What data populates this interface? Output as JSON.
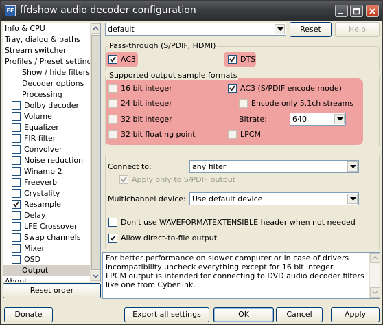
{
  "window": {
    "title": "ffdshow audio decoder configuration",
    "app_icon": "ffdshow-icon"
  },
  "tree": {
    "items": [
      {
        "label": "Info & CPU",
        "checkbox": null
      },
      {
        "label": "Tray, dialog & paths",
        "checkbox": null
      },
      {
        "label": "Stream switcher",
        "checkbox": null
      },
      {
        "label": "Profiles / Preset settings",
        "checkbox": null
      },
      {
        "label": "Show / hide filters",
        "checkbox": null
      },
      {
        "label": "Decoder options",
        "checkbox": null
      },
      {
        "label": "Processing",
        "checkbox": null
      },
      {
        "label": "Dolby decoder",
        "checkbox": false
      },
      {
        "label": "Volume",
        "checkbox": false
      },
      {
        "label": "Equalizer",
        "checkbox": false
      },
      {
        "label": "FIR filter",
        "checkbox": false
      },
      {
        "label": "Convolver",
        "checkbox": false
      },
      {
        "label": "Noise reduction",
        "checkbox": false
      },
      {
        "label": "Winamp 2",
        "checkbox": false
      },
      {
        "label": "Freeverb",
        "checkbox": false
      },
      {
        "label": "Crystality",
        "checkbox": false
      },
      {
        "label": "Resample",
        "checkbox": true
      },
      {
        "label": "Delay",
        "checkbox": false
      },
      {
        "label": "LFE Crossover",
        "checkbox": false
      },
      {
        "label": "Swap channels",
        "checkbox": false
      },
      {
        "label": "Mixer",
        "checkbox": false
      },
      {
        "label": "OSD",
        "checkbox": false
      },
      {
        "label": "Output",
        "checkbox": null,
        "selected": true
      },
      {
        "label": "About",
        "checkbox": null
      }
    ]
  },
  "reset_order_label": "Reset order",
  "preset": {
    "value": "default",
    "reset_label": "Reset",
    "help_label": "Help"
  },
  "passthrough": {
    "title": "Pass-through (S/PDIF, HDMI)",
    "ac3": {
      "label": "AC3",
      "checked": true
    },
    "dts": {
      "label": "DTS",
      "checked": true
    }
  },
  "formats": {
    "title": "Supported output sample formats",
    "bit16": {
      "label": "16 bit integer",
      "checked": false
    },
    "bit24": {
      "label": "24 bit integer",
      "checked": false
    },
    "bit32": {
      "label": "32 bit integer",
      "checked": false
    },
    "float32": {
      "label": "32 bit floating point",
      "checked": false
    },
    "ac3enc": {
      "label": "AC3 (S/PDIF encode mode)",
      "checked": true
    },
    "only51": {
      "label": "Encode only 5.1ch streams",
      "checked": false
    },
    "bitrate_label": "Bitrate:",
    "bitrate_value": "640",
    "lpcm": {
      "label": "LPCM",
      "checked": false
    }
  },
  "connect": {
    "label": "Connect to:",
    "value": "any filter",
    "spdif_only_label": "Apply only to S/PDIF output",
    "spdif_only_checked": true
  },
  "multichannel": {
    "label": "Multichannel device:",
    "value": "Use default device"
  },
  "waveformat": {
    "label": "Don't use WAVEFORMATEXTENSIBLE header when not needed",
    "checked": false
  },
  "direct": {
    "label": "Allow direct-to-file output",
    "checked": true
  },
  "info_text": "For better performance on slower computer or in case of drivers incompatibility uncheck everything except for 16 bit integer.\nLPCM output is intended for connecting to DVD audio decoder filters like one from Cyberlink.",
  "bottom": {
    "donate": "Donate",
    "export": "Export all settings",
    "ok": "OK",
    "cancel": "Cancel",
    "apply": "Apply"
  },
  "colors": {
    "highlight": "#f09a9a",
    "title_bar": "#3b3d41",
    "face": "#ece9d8"
  }
}
